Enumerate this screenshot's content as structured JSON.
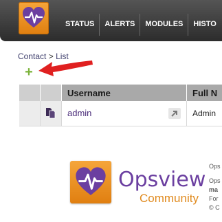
{
  "header": {
    "nav": [
      {
        "label": "STATUS"
      },
      {
        "label": "ALERTS"
      },
      {
        "label": "MODULES"
      },
      {
        "label": "HISTO"
      }
    ]
  },
  "breadcrumb": {
    "parent": "Contact",
    "separator": ">",
    "current": "List"
  },
  "add_button": {
    "label": "+"
  },
  "table": {
    "columns": [
      "Username",
      "Full N"
    ],
    "rows": [
      {
        "username": "admin",
        "full_name": "Admin"
      }
    ]
  },
  "footer": {
    "brand": "Opsview",
    "edition": "Community",
    "side_lines": [
      "Ops",
      "Ops",
      "ma",
      "For",
      "© C"
    ]
  },
  "colors": {
    "brand_orange": "#e88a1a",
    "brand_purple": "#6b3fa0",
    "add_green": "#7bb33a",
    "arrow_red": "#e02020"
  },
  "icons": {
    "logo": "heartbeat-heart-logo",
    "row_icon": "documents-icon",
    "go": "arrow-up-right-icon"
  }
}
